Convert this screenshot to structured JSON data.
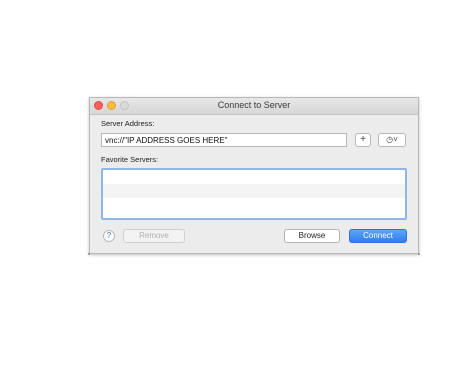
{
  "window": {
    "title": "Connect to Server"
  },
  "server_address": {
    "label": "Server Address:",
    "value": "vnc://\"IP ADDRESS GOES HERE\""
  },
  "add_button": {
    "label": "+"
  },
  "history_button": {
    "label": "◷˅"
  },
  "favorites": {
    "label": "Favorite Servers:",
    "rows": [
      "",
      "",
      ""
    ]
  },
  "help_button": {
    "label": "?"
  },
  "buttons": {
    "remove": "Remove",
    "browse": "Browse",
    "connect": "Connect"
  },
  "colors": {
    "accent": "#2d7ef0",
    "close": "#fc605c",
    "minimize": "#fdbc40"
  }
}
